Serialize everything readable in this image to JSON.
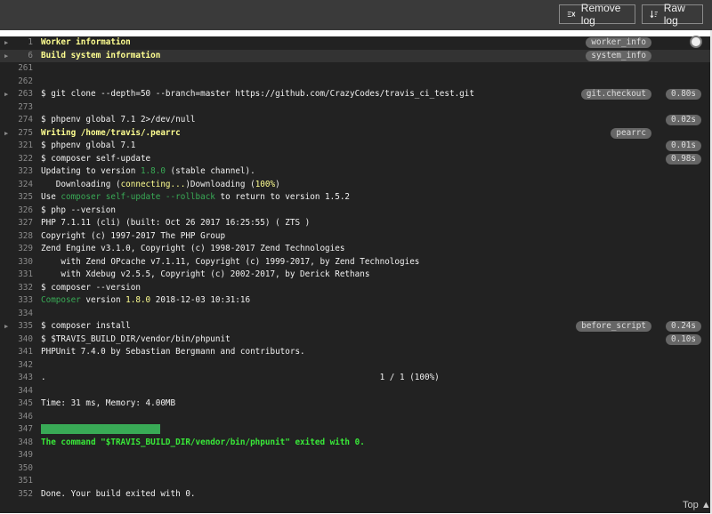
{
  "toolbar": {
    "remove_log": "Remove log",
    "raw_log": "Raw log"
  },
  "log_lines": [
    {
      "n": "1",
      "fold": true,
      "segments": [
        {
          "t": "Worker information",
          "c": "fold-bold"
        }
      ],
      "label": "worker_info"
    },
    {
      "n": "6",
      "fold": true,
      "hl": true,
      "segments": [
        {
          "t": "Build system information",
          "c": "fold-bold"
        }
      ],
      "label": "system_info"
    },
    {
      "n": "261",
      "segments": []
    },
    {
      "n": "262",
      "segments": []
    },
    {
      "n": "263",
      "fold": true,
      "segments": [
        {
          "t": "$ git clone --depth=50 --branch=master https://github.com/CrazyCodes/travis_ci_test.git",
          "c": ""
        }
      ],
      "label": "git.checkout",
      "time": "0.80s"
    },
    {
      "n": "273",
      "segments": []
    },
    {
      "n": "274",
      "segments": [
        {
          "t": "$ phpenv global 7.1 2>/dev/null",
          "c": ""
        }
      ],
      "time": "0.02s"
    },
    {
      "n": "275",
      "fold": true,
      "segments": [
        {
          "t": "Writing /home/travis/.pearrc",
          "c": "fold-bold"
        }
      ],
      "label": "pearrc"
    },
    {
      "n": "321",
      "segments": [
        {
          "t": "$ phpenv global 7.1",
          "c": ""
        }
      ],
      "time": "0.01s"
    },
    {
      "n": "322",
      "segments": [
        {
          "t": "$ composer self-update",
          "c": ""
        }
      ],
      "time": "0.98s"
    },
    {
      "n": "323",
      "segments": [
        {
          "t": "Updating to version ",
          "c": ""
        },
        {
          "t": "1.8.0",
          "c": "g"
        },
        {
          "t": " (stable channel).",
          "c": ""
        }
      ]
    },
    {
      "n": "324",
      "segments": [
        {
          "t": "   Downloading (",
          "c": ""
        },
        {
          "t": "connecting...",
          "c": "y"
        },
        {
          "t": ")Downloading (",
          "c": ""
        },
        {
          "t": "100%",
          "c": "y"
        },
        {
          "t": ")",
          "c": ""
        }
      ]
    },
    {
      "n": "325",
      "segments": [
        {
          "t": "Use ",
          "c": ""
        },
        {
          "t": "composer self-update --rollback",
          "c": "g"
        },
        {
          "t": " to return to version 1.5.2",
          "c": ""
        }
      ]
    },
    {
      "n": "326",
      "segments": [
        {
          "t": "$ php --version",
          "c": ""
        }
      ]
    },
    {
      "n": "327",
      "segments": [
        {
          "t": "PHP 7.1.11 (cli) (built: Oct 26 2017 16:25:55) ( ZTS )",
          "c": ""
        }
      ]
    },
    {
      "n": "328",
      "segments": [
        {
          "t": "Copyright (c) 1997-2017 The PHP Group",
          "c": ""
        }
      ]
    },
    {
      "n": "329",
      "segments": [
        {
          "t": "Zend Engine v3.1.0, Copyright (c) 1998-2017 Zend Technologies",
          "c": ""
        }
      ]
    },
    {
      "n": "330",
      "segments": [
        {
          "t": "    with Zend OPcache v7.1.11, Copyright (c) 1999-2017, by Zend Technologies",
          "c": ""
        }
      ]
    },
    {
      "n": "331",
      "segments": [
        {
          "t": "    with Xdebug v2.5.5, Copyright (c) 2002-2017, by Derick Rethans",
          "c": ""
        }
      ]
    },
    {
      "n": "332",
      "segments": [
        {
          "t": "$ composer --version",
          "c": ""
        }
      ]
    },
    {
      "n": "333",
      "segments": [
        {
          "t": "Composer",
          "c": "g"
        },
        {
          "t": " version ",
          "c": ""
        },
        {
          "t": "1.8.0",
          "c": "y"
        },
        {
          "t": " 2018-12-03 10:31:16",
          "c": ""
        }
      ]
    },
    {
      "n": "334",
      "segments": []
    },
    {
      "n": "335",
      "fold": true,
      "segments": [
        {
          "t": "$ composer install",
          "c": ""
        }
      ],
      "label": "before_script",
      "time": "0.24s"
    },
    {
      "n": "340",
      "segments": [
        {
          "t": "$ $TRAVIS_BUILD_DIR/vendor/bin/phpunit",
          "c": ""
        }
      ],
      "time": "0.10s"
    },
    {
      "n": "341",
      "segments": [
        {
          "t": "PHPUnit 7.4.0 by Sebastian Bergmann and contributors.",
          "c": ""
        }
      ]
    },
    {
      "n": "342",
      "segments": []
    },
    {
      "n": "343",
      "segments": [
        {
          "t": ".                                                                   1 / 1 (100%)",
          "c": ""
        }
      ]
    },
    {
      "n": "344",
      "segments": []
    },
    {
      "n": "345",
      "segments": [
        {
          "t": "Time: 31 ms, Memory: 4.00MB",
          "c": ""
        }
      ]
    },
    {
      "n": "346",
      "segments": []
    },
    {
      "n": "347",
      "segments": [
        {
          "t": "OK (1 test, 1 assertion)",
          "c": "okbg"
        }
      ]
    },
    {
      "n": "348",
      "segments": [
        {
          "t": "The command \"$TRAVIS_BUILD_DIR/vendor/bin/phpunit\" exited with 0.",
          "c": "green-bold"
        }
      ]
    },
    {
      "n": "349",
      "segments": []
    },
    {
      "n": "350",
      "segments": []
    },
    {
      "n": "351",
      "segments": []
    },
    {
      "n": "352",
      "segments": [
        {
          "t": "Done. Your build exited with 0.",
          "c": ""
        }
      ]
    }
  ],
  "footer": {
    "top_label": "Top"
  }
}
